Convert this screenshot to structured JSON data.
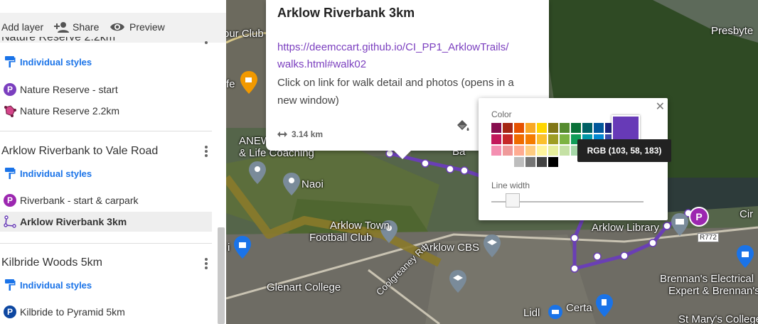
{
  "toolbar": {
    "add_layer": "Add layer",
    "share": "Share",
    "preview": "Preview"
  },
  "sidebar": {
    "partial_title": "Nature Reserve 2.2km",
    "layer1": {
      "styles": "Individual styles",
      "items": [
        {
          "label": "Nature Reserve - start",
          "icon": "parking-pin-icon",
          "color": "#7b3fbf"
        },
        {
          "label": "Nature Reserve 2.2km",
          "icon": "polygon-icon",
          "color": "#c2185b"
        }
      ]
    },
    "layer2": {
      "title": "Arklow Riverbank to Vale Road",
      "styles": "Individual styles",
      "items": [
        {
          "label": "Riverbank - start & carpark",
          "icon": "parking-pin-icon",
          "color": "#9c27b0"
        },
        {
          "label": "Arklow Riverbank 3km",
          "icon": "line-icon",
          "color": "#673ab7"
        }
      ]
    },
    "layer3": {
      "title": "Kilbride Woods 5km",
      "styles": "Individual styles",
      "items": [
        {
          "label": "Kilbride to Pyramid 5km",
          "icon": "parking-pin-icon",
          "color": "#0d47a1"
        }
      ]
    }
  },
  "map": {
    "labels": {
      "presbyter": "Presbyte",
      "our_club": "our Club",
      "fe": "fe",
      "anew": "ANEW",
      "life_coaching": "& Life Coaching",
      "naoi": "Naoi",
      "arklow_town": "Arklow Town",
      "football_club": "Football Club",
      "arklow_cbs": "Arklow CBS",
      "glenart": "Glenart College",
      "coolgreaney": "Coolgreaney Rd",
      "arklow_library": "Arklow Library",
      "r772": "R772",
      "brennans1": "Brennan's Electrical",
      "brennans2": "Expert & Brennan's",
      "lidl": "Lidl",
      "certa": "Certa",
      "st_marys": "St Mary's College",
      "cir": "Cir",
      "ba": "Ba",
      "i": "i"
    },
    "accent_route_color": "#6a3fb5",
    "accent_route2_color": "#8a7a2a"
  },
  "popup": {
    "title": "Arklow Riverbank 3km",
    "link_line1": "https://deemccart.github.io/CI_PP1_ArklowTrails/",
    "link_line2": "walks.html#walk02",
    "description": "Click on link for walk detail and photos (opens in a new window)",
    "distance": "3.14 km"
  },
  "style_panel": {
    "color_label": "Color",
    "line_width_label": "Line width",
    "tooltip": "RGB (103, 58, 183)",
    "selected_color": "#673ab7",
    "palette_rows": [
      [
        "#880e4f",
        "#a52714",
        "#e65100",
        "#f9a825",
        "#ffd600",
        "#817717",
        "#558b2f",
        "#097138",
        "#006064",
        "#01579b",
        "#1a237e",
        "#673ab7",
        "#4e342e"
      ],
      [
        "#c2185b",
        "#c62828",
        "#ef6c00",
        "#f57c00",
        "#fbc02d",
        "#9e9d24",
        "#7cb342",
        "#0f9d58",
        "#0097a7",
        "#0288d1",
        "#3949ab",
        "#7b1fa2",
        "#6d4c41"
      ],
      [
        "#f48fb1",
        "#ef9a9a",
        "#ffab91",
        "#ffcc80",
        "#fff59d",
        "#e6ee9c",
        "#c5e1a5",
        "#a5d6a7",
        "#80deea",
        "#81d4fa",
        "#9fa8da",
        "#ce93d8",
        "#bcaaa4"
      ],
      [
        "#ffffff",
        "#bdbdbd",
        "#757575",
        "#424242",
        "#000000"
      ]
    ]
  }
}
